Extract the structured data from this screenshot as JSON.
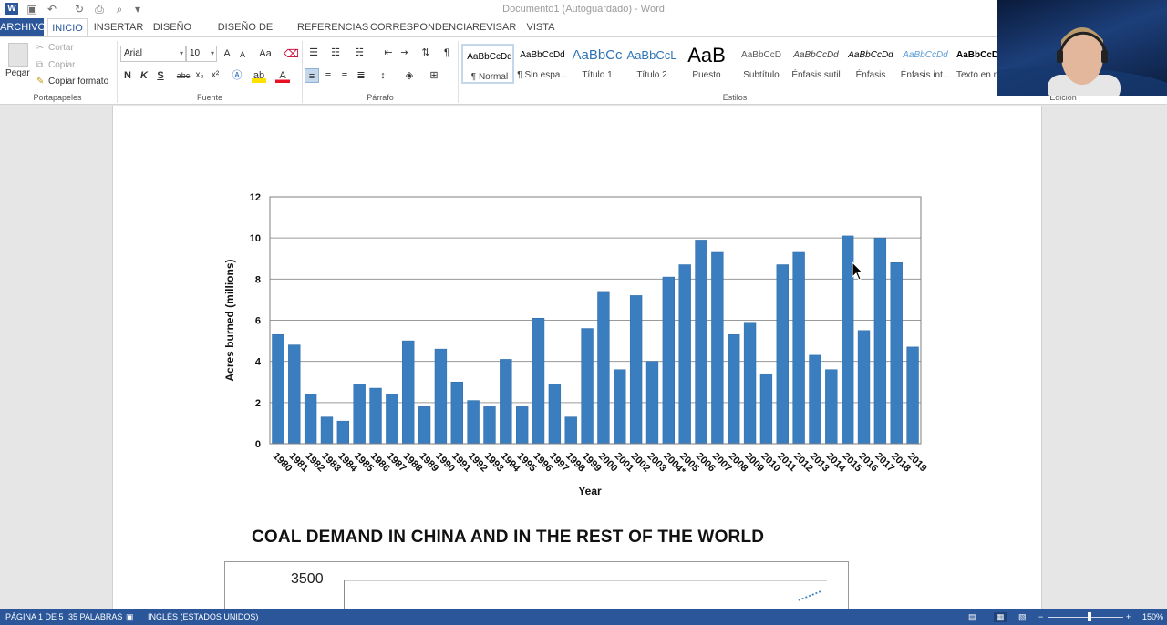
{
  "window": {
    "title": "Documento1 (Autoguardado) - Word"
  },
  "tabs": [
    "ARCHIVO",
    "INICIO",
    "INSERTAR",
    "DISEÑO",
    "DISEÑO DE PÁGINA",
    "REFERENCIAS",
    "CORRESPONDENCIA",
    "REVISAR",
    "VISTA"
  ],
  "ribbon": {
    "clipboard": {
      "paste": "Pegar",
      "cut": "Cortar",
      "copy": "Copiar",
      "format_painter": "Copiar formato",
      "label": "Portapapeles"
    },
    "font": {
      "name": "Arial",
      "size": "10",
      "label": "Fuente",
      "bold": "N",
      "italic": "K",
      "underline": "S",
      "strike": "abc",
      "subscript": "x₂",
      "superscript": "x²",
      "grow": "A",
      "shrink": "A",
      "case": "Aa"
    },
    "paragraph": {
      "label": "Párrafo"
    },
    "styles": {
      "label": "Estilos",
      "items": [
        {
          "sample": "AaBbCcDd",
          "name": "¶ Normal"
        },
        {
          "sample": "AaBbCcDd",
          "name": "¶ Sin espa..."
        },
        {
          "sample": "AaBbCc",
          "name": "Título 1"
        },
        {
          "sample": "AaBbCcL",
          "name": "Título 2"
        },
        {
          "sample": "AaB",
          "name": "Puesto"
        },
        {
          "sample": "AaBbCcD",
          "name": "Subtítulo"
        },
        {
          "sample": "AaBbCcDd",
          "name": "Énfasis sutil"
        },
        {
          "sample": "AaBbCcDd",
          "name": "Énfasis"
        },
        {
          "sample": "AaBbCcDd",
          "name": "Énfasis int..."
        },
        {
          "sample": "AaBbCcD",
          "name": "Texto en n"
        }
      ]
    },
    "editing": {
      "label": "Edición"
    }
  },
  "document": {
    "heading2": "COAL DEMAND IN CHINA AND IN THE REST OF THE WORLD",
    "chart2_first_tick": "3500"
  },
  "chart_data": [
    {
      "type": "bar",
      "title": "",
      "xlabel": "Year",
      "ylabel": "Acres burned (millions)",
      "ylim": [
        0,
        12
      ],
      "yticks": [
        "0",
        "2",
        "4",
        "6",
        "8",
        "10",
        "12"
      ],
      "grid": true,
      "color": "#3a7ebf",
      "categories": [
        "1980",
        "1981",
        "1982",
        "1983",
        "1984",
        "1985",
        "1986",
        "1987",
        "1988",
        "1989",
        "1990",
        "1991",
        "1992",
        "1993",
        "1994",
        "1995",
        "1996",
        "1997",
        "1998",
        "1999",
        "2000",
        "2001",
        "2002",
        "2003",
        "2004*",
        "2005",
        "2006",
        "2007",
        "2008",
        "2009",
        "2010",
        "2011",
        "2012",
        "2013",
        "2014",
        "2015",
        "2016",
        "2017",
        "2018",
        "2019"
      ],
      "values": [
        5.3,
        4.8,
        2.4,
        1.3,
        1.1,
        2.9,
        2.7,
        2.4,
        5.0,
        1.8,
        4.6,
        3.0,
        2.1,
        1.8,
        4.1,
        1.8,
        6.1,
        2.9,
        1.3,
        5.6,
        7.4,
        3.6,
        7.2,
        4.0,
        8.1,
        8.7,
        9.9,
        9.3,
        5.3,
        5.9,
        3.4,
        8.7,
        9.3,
        4.3,
        3.6,
        10.1,
        5.5,
        10.0,
        8.8,
        4.7
      ]
    }
  ],
  "status": {
    "page": "PÁGINA 1 DE 5",
    "words": "35 PALABRAS",
    "language": "INGLÉS (ESTADOS UNIDOS)",
    "zoom": "150%"
  }
}
